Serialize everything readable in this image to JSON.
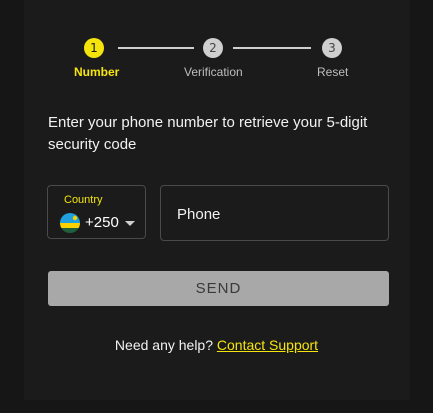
{
  "stepper": {
    "steps": [
      {
        "number": "1",
        "label": "Number"
      },
      {
        "number": "2",
        "label": "Verification"
      },
      {
        "number": "3",
        "label": "Reset"
      }
    ],
    "active_step": 1
  },
  "instruction": "Enter your phone number to retrieve your 5-digit security code",
  "country": {
    "label": "Country",
    "dial_code": "+250",
    "flag_icon": "rwanda-flag-icon"
  },
  "phone": {
    "placeholder": "Phone",
    "value": ""
  },
  "send_button": {
    "label": "SEND"
  },
  "help": {
    "text": "Need any help?",
    "link": "Contact Support"
  },
  "colors": {
    "accent": "#f5e50c",
    "background": "#161616",
    "button_disabled": "#a8a8a8"
  }
}
